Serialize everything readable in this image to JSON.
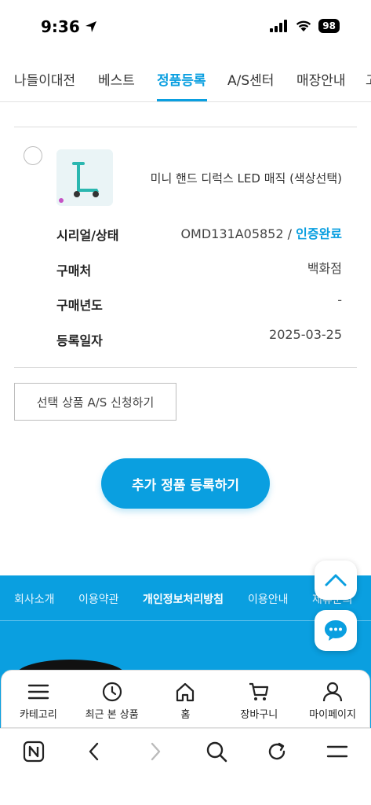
{
  "status_bar": {
    "time": "9:36",
    "battery": "98"
  },
  "nav": {
    "tabs": [
      {
        "label": "나들이대전",
        "active": false
      },
      {
        "label": "베스트",
        "active": false
      },
      {
        "label": "정품등록",
        "active": true
      },
      {
        "label": "A/S센터",
        "active": false
      },
      {
        "label": "매장안내",
        "active": false
      },
      {
        "label": "고",
        "active": false
      }
    ]
  },
  "product": {
    "name": "미니 핸드 디럭스 LED 매직 (색상선택)",
    "info": [
      {
        "label": "시리얼/상태",
        "value": "OMD131A05852",
        "separator": " / ",
        "status": "인증완료"
      },
      {
        "label": "구매처",
        "value": "백화점"
      },
      {
        "label": "구매년도",
        "value": "-"
      },
      {
        "label": "등록일자",
        "value": "2025-03-25"
      }
    ]
  },
  "actions": {
    "as_request": "선택 상품 A/S 신청하기",
    "add_register": "추가 정품 등록하기"
  },
  "footer": {
    "links": [
      {
        "label": "회사소개"
      },
      {
        "label": "이용약관"
      },
      {
        "label": "개인정보처리방침"
      },
      {
        "label": "이용안내"
      },
      {
        "label": "제휴문의"
      }
    ]
  },
  "app_nav": [
    {
      "label": "카테고리",
      "icon": "menu-icon"
    },
    {
      "label": "최근 본 상품",
      "icon": "clock-icon"
    },
    {
      "label": "홈",
      "icon": "home-icon"
    },
    {
      "label": "장바구니",
      "icon": "cart-icon"
    },
    {
      "label": "마이페이지",
      "icon": "user-icon"
    }
  ],
  "colors": {
    "accent": "#0a9fe0"
  }
}
